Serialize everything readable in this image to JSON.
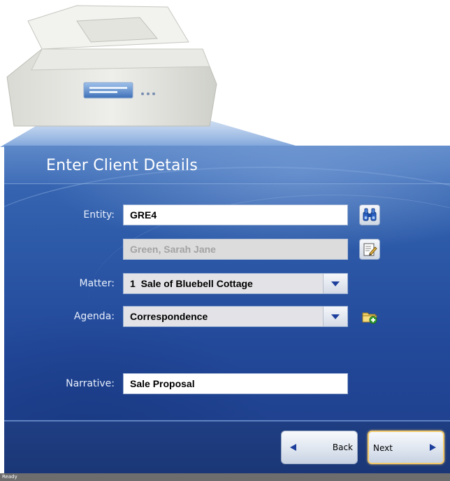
{
  "window": {
    "title": "Enter Client Details"
  },
  "form": {
    "entity_label": "Entity:",
    "entity_value": "GRE4",
    "client_name": "Green, Sarah Jane",
    "matter_label": "Matter:",
    "matter_value": "1  Sale of Bluebell Cottage",
    "agenda_label": "Agenda:",
    "agenda_value": "Correspondence",
    "narrative_label": "Narrative:",
    "narrative_value": "Sale Proposal"
  },
  "icons": {
    "entity_lookup": "binoculars-icon",
    "client_details": "edit-document-icon",
    "agenda_new": "new-folder-icon",
    "matter_dropdown": "chevron-down-icon",
    "agenda_dropdown": "chevron-down-icon"
  },
  "nav": {
    "back_label": "Back",
    "next_label": "Next"
  },
  "status": {
    "text": "Ready"
  },
  "colors": {
    "panel_blue": "#2d5aa8",
    "footer_blue": "#1f3e83",
    "accent_arrow": "#1d3f9c",
    "next_highlight": "#f2c96a"
  }
}
